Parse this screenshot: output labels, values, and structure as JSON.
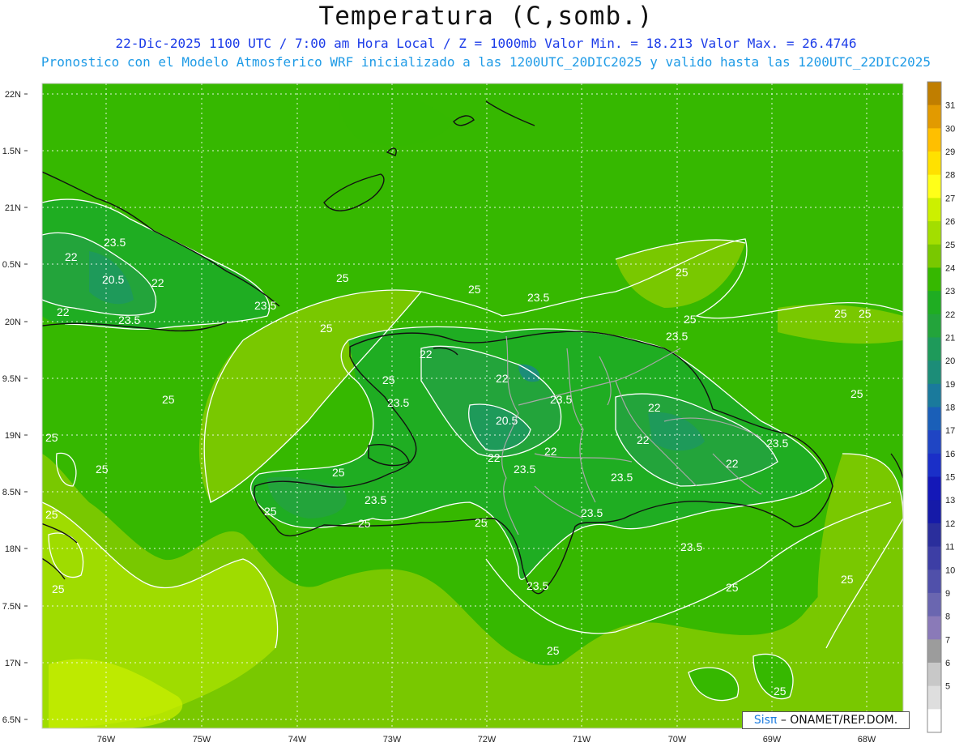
{
  "header": {
    "title": "Temperatura (C,somb.)",
    "line1": "22-Dic-2025  1100 UTC / 7:00 am Hora Local / Z = 1000mb    Valor Min. = 18.213  Valor Max. = 26.4746",
    "line2": "Pronostico con el Modelo Atmosferico WRF inicializado a las 1200UTC_20DIC2025 y valido hasta las  1200UTC_22DIC2025"
  },
  "axes": {
    "lat_labels": [
      "22N",
      "1.5N",
      "21N",
      "0.5N",
      "20N",
      "9.5N",
      "19N",
      "8.5N",
      "18N",
      "7.5N",
      "17N",
      "6.5N"
    ],
    "lon_labels": [
      "76W",
      "75W",
      "74W",
      "73W",
      "72W",
      "71W",
      "70W",
      "69W",
      "68W"
    ]
  },
  "colorbar": {
    "labels": [
      "31",
      "30",
      "29",
      "28",
      "27",
      "26",
      "25",
      "24",
      "23",
      "22",
      "21",
      "20",
      "19",
      "18",
      "17",
      "16",
      "15",
      "13",
      "12",
      "11",
      "10",
      "9",
      "8",
      "7",
      "6",
      "5"
    ],
    "colors": [
      "#c07e00",
      "#e29a00",
      "#ffbf00",
      "#ffe100",
      "#ffff19",
      "#ccf000",
      "#a3de00",
      "#79c800",
      "#36b800",
      "#1fad22",
      "#23a43b",
      "#1e9a5a",
      "#1c8d78",
      "#1a7a9c",
      "#1a5fb8",
      "#1f45c4",
      "#1a2fc8",
      "#1418b8",
      "#151aa8",
      "#2a2e9c",
      "#3d3ea5",
      "#5050aa",
      "#6a66b0",
      "#8a7ab8",
      "#9c9c9c",
      "#c8c8c8",
      "#dedede",
      "#ffffff"
    ]
  },
  "contour_labels": [
    "23.5",
    "22",
    "20.5",
    "22",
    "22",
    "23.5",
    "25",
    "25",
    "25",
    "25",
    "23.5",
    "25",
    "22",
    "25",
    "23.5",
    "22",
    "20.5",
    "22",
    "22",
    "23.5",
    "23.5",
    "22",
    "22",
    "23.5",
    "23.5",
    "25",
    "25",
    "23.5",
    "25",
    "23.5",
    "25",
    "25",
    "25",
    "25",
    "25",
    "25",
    "23.5",
    "22",
    "25",
    "25"
  ],
  "credit": {
    "brand": "Sisπ",
    "rest": "– ONAMET/REP.DOM."
  }
}
